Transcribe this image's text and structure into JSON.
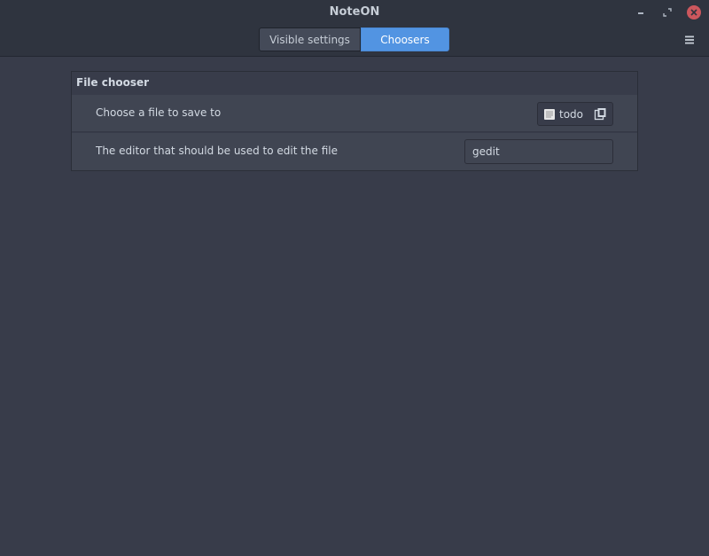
{
  "window": {
    "title": "NoteON"
  },
  "header": {
    "tabs": [
      {
        "label": "Visible settings",
        "active": false
      },
      {
        "label": "Choosers",
        "active": true
      }
    ],
    "menu_icon": "hamburger-menu-icon"
  },
  "frame": {
    "title": "File chooser",
    "rows": [
      {
        "label": "Choose a file to save to",
        "file_button": {
          "file_name": "todo",
          "file_icon": "text-file-icon",
          "open_icon": "open-document-icon"
        }
      },
      {
        "label": "The editor that should be used to edit the file",
        "input_value": "gedit"
      }
    ]
  },
  "colors": {
    "window_bg": "#383c4a",
    "headerbar_bg": "#2f343f",
    "row_bg": "#404552",
    "accent": "#5294e2",
    "close": "#cc575d"
  }
}
